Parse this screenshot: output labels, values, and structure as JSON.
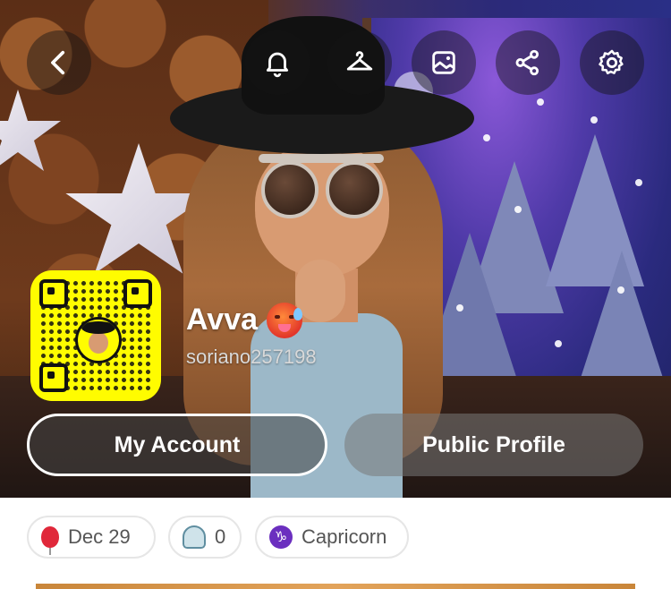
{
  "header": {
    "back_icon": "chevron-left-icon",
    "actions": [
      {
        "name": "notifications",
        "icon": "bell-icon"
      },
      {
        "name": "outfit",
        "icon": "hanger-icon"
      },
      {
        "name": "background",
        "icon": "image-icon"
      },
      {
        "name": "share",
        "icon": "share-icon"
      },
      {
        "name": "settings",
        "icon": "gear-icon"
      }
    ]
  },
  "profile": {
    "display_name": "Avva",
    "status_emoji": "hot-face-icon",
    "username": "soriano257198"
  },
  "buttons": {
    "my_account": "My Account",
    "public_profile": "Public Profile"
  },
  "chips": {
    "birthday": "Dec 29",
    "friends_count": "0",
    "zodiac_symbol": "♑",
    "zodiac": "Capricorn"
  },
  "colors": {
    "snapcode": "#fffc00",
    "zodiac_badge": "#6b2fbf",
    "birthday_balloon": "#e0283a"
  }
}
